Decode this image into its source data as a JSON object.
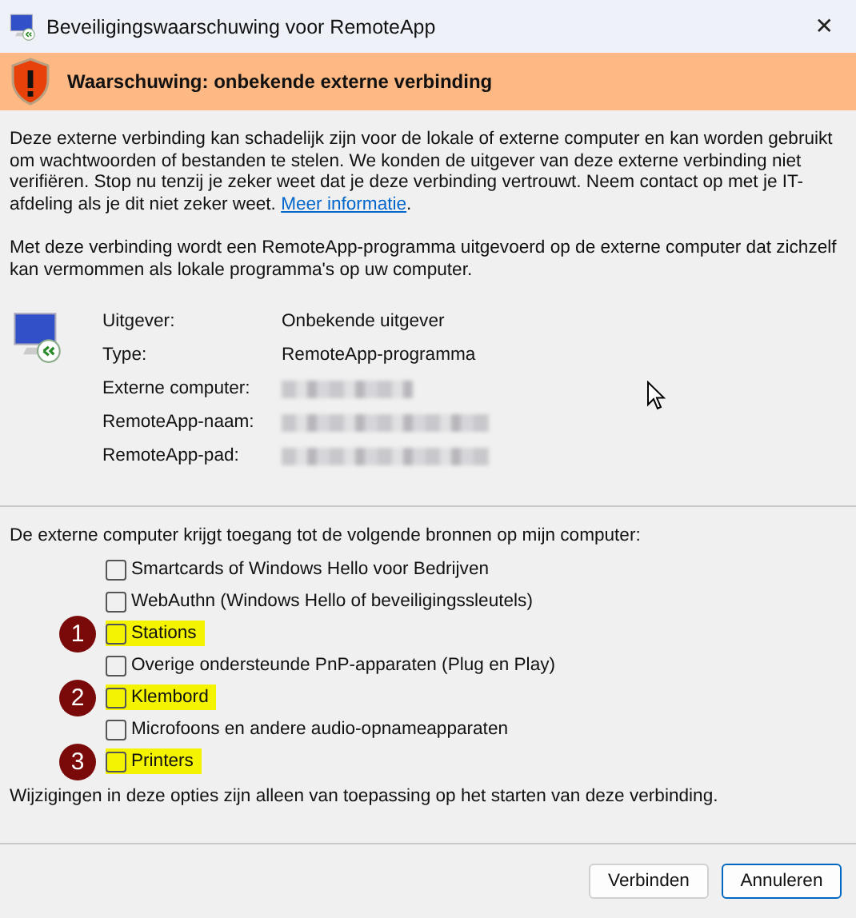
{
  "window": {
    "title": "Beveiligingswaarschuwing voor RemoteApp",
    "close": "✕"
  },
  "banner": {
    "title": "Waarschuwing: onbekende externe verbinding"
  },
  "warning": {
    "text": "Deze externe verbinding kan schadelijk zijn voor de lokale of externe computer en kan worden gebruikt om wachtwoorden of bestanden te stelen. We konden de uitgever van deze externe verbinding niet verifiëren. Stop nu tenzij je zeker weet dat je deze verbinding vertrouwt. Neem contact op met je IT-afdeling als je dit niet zeker weet.",
    "link": "Meer informatie",
    "after": "."
  },
  "description": "Met deze verbinding wordt een RemoteApp-programma uitgevoerd op de externe computer dat zichzelf kan vermommen als lokale programma's op uw computer.",
  "details": [
    {
      "label": "Uitgever:",
      "value": "Onbekende uitgever",
      "redacted": false
    },
    {
      "label": "Type:",
      "value": "RemoteApp-programma",
      "redacted": false
    },
    {
      "label": "Externe computer:",
      "redacted": true
    },
    {
      "label": "RemoteApp-naam:",
      "redacted": true
    },
    {
      "label": "RemoteApp-pad:",
      "redacted": true
    }
  ],
  "resources": {
    "heading": "De externe computer krijgt toegang tot de volgende bronnen op mijn computer:",
    "items": [
      {
        "label": "Smartcards of Windows Hello voor Bedrijven",
        "checked": false,
        "highlighted": false
      },
      {
        "label": "WebAuthn (Windows Hello of beveiligingssleutels)",
        "checked": false,
        "highlighted": false
      },
      {
        "label": "Stations",
        "checked": false,
        "highlighted": true,
        "badge": "1"
      },
      {
        "label": "Overige ondersteunde PnP-apparaten (Plug en Play)",
        "checked": false,
        "highlighted": false
      },
      {
        "label": "Klembord",
        "checked": false,
        "highlighted": true,
        "badge": "2"
      },
      {
        "label": "Microfoons en andere audio-opnameapparaten",
        "checked": false,
        "highlighted": false
      },
      {
        "label": "Printers",
        "checked": false,
        "highlighted": true,
        "badge": "3"
      }
    ],
    "note": "Wijzigingen in deze opties zijn alleen van toepassing op het starten van deze verbinding."
  },
  "buttons": [
    {
      "label": "Verbinden",
      "default": false
    },
    {
      "label": "Annuleren",
      "default": true
    }
  ]
}
